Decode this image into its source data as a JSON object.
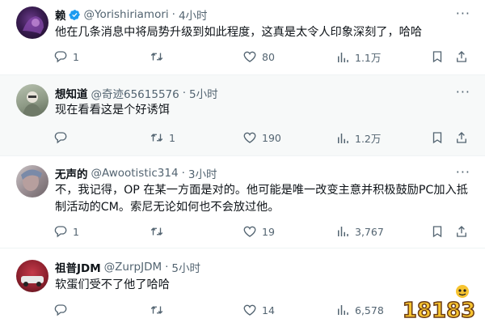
{
  "tweets": [
    {
      "name": "赖",
      "verified": true,
      "handle": "@Yorishiriamori",
      "time": "4小时",
      "text": "他在几条消息中将局势升级到如此程度，这真是太令人印象深刻了，哈哈",
      "replies": "1",
      "retweets": "",
      "likes": "80",
      "views": "1.1万"
    },
    {
      "name": "想知道",
      "verified": false,
      "handle": "@奇迹65615576",
      "time": "5小时",
      "text": "现在看看这是个好诱饵",
      "replies": "",
      "retweets": "1",
      "likes": "190",
      "views": "1.2万"
    },
    {
      "name": "无声的",
      "verified": false,
      "handle": "@Awootistic314",
      "time": "3小时",
      "text": "不，我记得，OP 在某一方面是对的。他可能是唯一改变主意并积极鼓励PC加入抵制活动的CM。索尼无论如何也不会放过他。",
      "replies": "1",
      "retweets": "",
      "likes": "19",
      "views": "3,767"
    },
    {
      "name": "祖普JDM",
      "verified": false,
      "handle": "@ZurpJDM",
      "time": "5小时",
      "text": "软蛋们受不了他了哈哈",
      "replies": "",
      "retweets": "",
      "likes": "14",
      "views": "6,578"
    }
  ],
  "separator": "·",
  "more_label": "···",
  "watermark": "18183",
  "colors": {
    "text": "#0f1419",
    "muted": "#536471",
    "verified": "#1d9bf0",
    "divider": "#eff3f4"
  },
  "icons": [
    "reply-icon",
    "retweet-icon",
    "like-icon",
    "views-icon",
    "bookmark-icon",
    "share-icon",
    "more-icon",
    "verified-icon"
  ]
}
